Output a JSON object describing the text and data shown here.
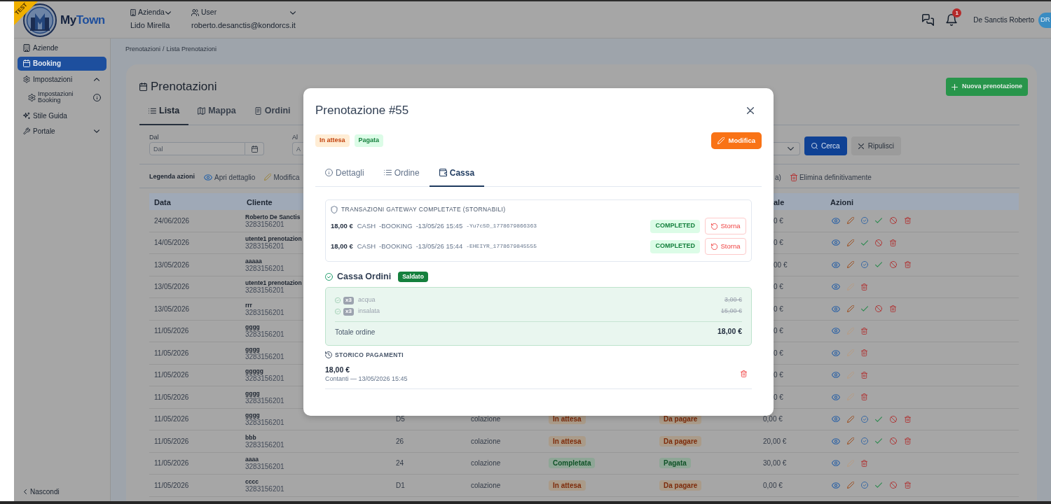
{
  "header": {
    "ribbon": "TEST",
    "brand": {
      "first": "My",
      "second": "Town"
    },
    "company": {
      "label": "Azienda",
      "value": "Lido Mirella"
    },
    "user": {
      "label": "User",
      "value": "roberto.desanctis@kondorcs.it"
    },
    "notification_count": "1",
    "user_name": "De Sanctis Roberto",
    "avatar": "DR"
  },
  "sidebar": {
    "items": [
      {
        "label": "Aziende",
        "selected": false
      },
      {
        "label": "Booking",
        "selected": true
      },
      {
        "label": "Impostazioni",
        "selected": false,
        "expanded": true,
        "children": [
          {
            "label": "Impostazioni Booking",
            "selected": false
          }
        ]
      },
      {
        "label": "Stile Guida",
        "selected": false
      },
      {
        "label": "Portale",
        "selected": false,
        "expanded": false
      }
    ],
    "collapse": "Nascondi"
  },
  "breadcrumb": {
    "items": [
      "Prenotazioni",
      "Lista Prenotazioni"
    ],
    "separator": "/"
  },
  "page": {
    "title": "Prenotazioni",
    "new_button": "Nuova prenotazione",
    "tabs": [
      {
        "label": "Lista",
        "selected": true
      },
      {
        "label": "Mappa",
        "selected": false
      },
      {
        "label": "Ordini",
        "selected": false
      }
    ],
    "filters": {
      "fields": [
        {
          "label": "Dal",
          "placeholder": "Dal"
        },
        {
          "label": "Al",
          "placeholder": "A"
        }
      ],
      "search_button": "Cerca",
      "clear_button": "Ripulisci"
    },
    "legend": {
      "title": "Legenda azioni",
      "items": [
        {
          "kind": "view",
          "label": "Apri dettaglio"
        },
        {
          "kind": "edit",
          "label": "Modifica"
        },
        {
          "kind": "text",
          "label": "a)"
        },
        {
          "kind": "delete",
          "label": "Elimina definitivamente"
        }
      ]
    }
  },
  "table": {
    "columns": [
      "Data",
      "Cliente",
      "ale",
      "Azioni"
    ],
    "rows": [
      {
        "date": "24/06/2026",
        "client": "Roberto De Sanctis",
        "phone": "3283156201",
        "total": "0 €",
        "editable": true,
        "actions": [
          {
            "kind": "view"
          },
          {
            "kind": "edit"
          },
          {
            "kind": "confirm"
          },
          {
            "kind": "complete"
          },
          {
            "kind": "cancel"
          },
          {
            "kind": "delete"
          }
        ]
      },
      {
        "date": "14/05/2026",
        "client": "utente1 prenotazion",
        "phone": "3283156201",
        "total": "0 €",
        "editable": true,
        "actions": [
          {
            "kind": "view"
          },
          {
            "kind": "edit"
          },
          {
            "kind": "complete"
          },
          {
            "kind": "cancel"
          },
          {
            "kind": "delete"
          }
        ]
      },
      {
        "date": "13/05/2026",
        "client": "aaaaa",
        "phone": "3283156201",
        "total": "00 €",
        "editable": true,
        "actions": [
          {
            "kind": "view"
          },
          {
            "kind": "edit"
          },
          {
            "kind": "confirm"
          },
          {
            "kind": "complete"
          },
          {
            "kind": "cancel"
          },
          {
            "kind": "delete"
          }
        ]
      },
      {
        "date": "13/05/2026",
        "client": "utente1 prenotazion",
        "phone": "3283156201",
        "total": "0 €",
        "editable": false,
        "actions": [
          {
            "kind": "view"
          },
          {
            "kind": "edit"
          },
          {
            "kind": "delete"
          }
        ]
      },
      {
        "date": "13/05/2026",
        "client": "rrr",
        "phone": "3283156201",
        "total": "0 €",
        "editable": true,
        "actions": [
          {
            "kind": "view"
          },
          {
            "kind": "edit"
          },
          {
            "kind": "complete"
          },
          {
            "kind": "cancel"
          },
          {
            "kind": "delete"
          }
        ]
      },
      {
        "date": "11/05/2026",
        "client": "gggg",
        "phone": "3283156201",
        "total": "0 €",
        "editable": false,
        "actions": [
          {
            "kind": "view"
          },
          {
            "kind": "edit"
          },
          {
            "kind": "delete"
          }
        ]
      },
      {
        "date": "11/05/2026",
        "client": "gggg",
        "phone": "3283156201",
        "total": "0 €",
        "editable": false,
        "actions": [
          {
            "kind": "view"
          },
          {
            "kind": "edit"
          },
          {
            "kind": "delete"
          }
        ]
      },
      {
        "date": "11/05/2026",
        "client": "ggggg",
        "phone": "3283156201",
        "total": "0 €",
        "editable": false,
        "actions": [
          {
            "kind": "view"
          },
          {
            "kind": "edit"
          },
          {
            "kind": "delete"
          }
        ]
      },
      {
        "date": "11/05/2026",
        "client": "gggg",
        "phone": "3283156201",
        "total": "0 €",
        "editable": false,
        "actions": [
          {
            "kind": "view"
          },
          {
            "kind": "edit"
          },
          {
            "kind": "delete"
          }
        ]
      },
      {
        "date": "11/05/2026",
        "client": "gggg",
        "phone": "3283156201",
        "place": "D5",
        "service": "colazione",
        "status": {
          "label": "In attesa",
          "kind": "warning"
        },
        "payment": {
          "label": "Da pagare",
          "kind": "warning"
        },
        "total": "0,00 €",
        "editable": true,
        "actions": [
          {
            "kind": "view"
          },
          {
            "kind": "edit"
          },
          {
            "kind": "confirm"
          },
          {
            "kind": "complete"
          },
          {
            "kind": "cancel"
          },
          {
            "kind": "delete"
          }
        ]
      },
      {
        "date": "11/05/2026",
        "client": "bbb",
        "phone": "3283156201",
        "place": "26",
        "service": "colazione",
        "status": {
          "label": "In attesa",
          "kind": "warning"
        },
        "payment": {
          "label": "Da pagare",
          "kind": "warning"
        },
        "total": "20,00 €",
        "editable": true,
        "actions": [
          {
            "kind": "view"
          },
          {
            "kind": "edit"
          },
          {
            "kind": "confirm"
          },
          {
            "kind": "complete"
          },
          {
            "kind": "cancel"
          },
          {
            "kind": "delete"
          }
        ]
      },
      {
        "date": "11/05/2026",
        "client": "aaaa",
        "phone": "3283156201",
        "place": "24",
        "service": "colazione",
        "status": {
          "label": "Completata",
          "kind": "success"
        },
        "payment": {
          "label": "Pagata",
          "kind": "success"
        },
        "total": "30,00 €",
        "editable": false,
        "actions": [
          {
            "kind": "view"
          },
          {
            "kind": "edit"
          },
          {
            "kind": "delete"
          }
        ]
      },
      {
        "date": "11/05/2026",
        "client": "cccc",
        "phone": "3283156201",
        "place": "D1",
        "service": "colazione",
        "status": {
          "label": "In attesa",
          "kind": "warning"
        },
        "payment": {
          "label": "Da pagare",
          "kind": "warning"
        },
        "total": "0,00 €",
        "editable": true,
        "actions": [
          {
            "kind": "view"
          },
          {
            "kind": "edit"
          },
          {
            "kind": "confirm"
          },
          {
            "kind": "complete"
          },
          {
            "kind": "cancel"
          },
          {
            "kind": "delete"
          }
        ]
      }
    ]
  },
  "modal": {
    "title": "Prenotazione #55",
    "badges": [
      {
        "label": "In attesa",
        "kind": "warning"
      },
      {
        "label": "Pagata",
        "kind": "success"
      }
    ],
    "edit_button": "Modifica",
    "tabs": [
      {
        "label": "Dettagli",
        "selected": false
      },
      {
        "label": "Ordine",
        "selected": false
      },
      {
        "label": "Cassa",
        "selected": true
      }
    ],
    "transactions": {
      "title": "TRANSAZIONI GATEWAY COMPLETATE (STORNABILI)",
      "rows": [
        {
          "amount": "18,00 €",
          "method": "CASH",
          "source": "-BOOKING",
          "time": "-13/05/26 15:45",
          "reference": "-Yu7c5D_1778679866363",
          "status": "COMPLETED",
          "action": "Storna"
        },
        {
          "amount": "18,00 €",
          "method": "CASH",
          "source": "-BOOKING",
          "time": "-13/05/26 15:44",
          "reference": "-EHEIYR_1778679845555",
          "status": "COMPLETED",
          "action": "Storna"
        }
      ]
    },
    "orders": {
      "title": "Cassa Ordini",
      "badge": "Saldato",
      "items": [
        {
          "quantity": "x3",
          "name": "acqua",
          "price": "3,00 €",
          "paid": true
        },
        {
          "quantity": "x3",
          "name": "insalata",
          "price": "15,00 €",
          "paid": true
        }
      ],
      "total_label": "Totale ordine",
      "total": "18,00 €"
    },
    "payments": {
      "title": "STORICO PAGAMENTI",
      "items": [
        {
          "amount": "18,00 €",
          "detail": "Contanti — 13/05/2026 15:45"
        }
      ]
    }
  }
}
